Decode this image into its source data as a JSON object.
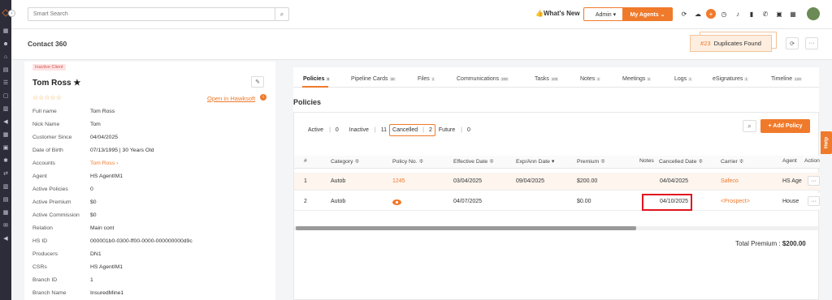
{
  "topbar": {
    "search_placeholder": "Smart Search",
    "whats_new": "👍What's New",
    "admin_label": "Admin ▾",
    "my_agents_label": "My Agents ⌄"
  },
  "header": {
    "title": "Contact 360",
    "duplicates_count": "#23",
    "duplicates_label": "Duplicates Found"
  },
  "contact": {
    "status_tag": "Inactive Client",
    "name": "Tom Ross ★",
    "stars": "☆☆☆☆☆",
    "hawksoft_link": "Open in Hawksoft",
    "fields": [
      {
        "label": "Full name",
        "value": "Tom Ross"
      },
      {
        "label": "Nick Name",
        "value": "Tom"
      },
      {
        "label": "Customer Since",
        "value": "04/04/2025"
      },
      {
        "label": "Date of Birth",
        "value": "07/13/1995 | 30 Years Old"
      },
      {
        "label": "Accounts",
        "value": "Tom Ross ›"
      },
      {
        "label": "Agent",
        "value": "HS AgentIM1"
      },
      {
        "label": "Active Policies",
        "value": "0"
      },
      {
        "label": "Active Premium",
        "value": "$0"
      },
      {
        "label": "Active Commission",
        "value": "$0"
      },
      {
        "label": "Relation",
        "value": "Main cont"
      },
      {
        "label": "HS ID",
        "value": "000001b0-0300-ff00-0000-000000000d9c"
      },
      {
        "label": "Producers",
        "value": "DN1"
      },
      {
        "label": "CSRs",
        "value": "HS AgentIM1"
      },
      {
        "label": "Branch ID",
        "value": "1"
      },
      {
        "label": "Branch Name",
        "value": "InsuredMine1"
      }
    ]
  },
  "tabs": [
    {
      "label": "Policies",
      "count": "8"
    },
    {
      "label": "Pipeline Cards",
      "count": "38"
    },
    {
      "label": "Files",
      "count": "1"
    },
    {
      "label": "Communications",
      "count": "209"
    },
    {
      "label": "Tasks",
      "count": "100"
    },
    {
      "label": "Notes",
      "count": "4"
    },
    {
      "label": "Meetings",
      "count": "5"
    },
    {
      "label": "Logs",
      "count": "1"
    },
    {
      "label": "eSignatures",
      "count": "1"
    },
    {
      "label": "Timeline",
      "count": "129"
    }
  ],
  "policies": {
    "title": "Policies",
    "filters": {
      "active_label": "Active",
      "active_count": "0",
      "inactive_label": "Inactive",
      "inactive_count": "11",
      "cancelled_label": "Cancelled",
      "cancelled_count": "2",
      "future_label": "Future",
      "future_count": "0"
    },
    "add_button": "+ Add Policy",
    "columns": [
      "#",
      "Category ≑",
      "Policy No. ≑",
      "Effective Date ≑",
      "Exp/Ann Date ▾",
      "Premium ≑",
      "Notes",
      "Cancelled Date ≑",
      "Carrier ≑",
      "Agent",
      "Action"
    ],
    "rows": [
      {
        "num": "1",
        "category": "Autob",
        "policy_no": "1245",
        "effective": "03/04/2025",
        "exp": "09/04/2025",
        "premium": "$200.00",
        "cancelled": "04/04/2025",
        "carrier": "Safeco",
        "agent": "HS Age"
      },
      {
        "num": "2",
        "category": "Autob",
        "policy_no": "",
        "effective": "04/07/2025",
        "exp": "",
        "premium": "$0.00",
        "cancelled": "04/10/2025",
        "carrier": "<Prospect>",
        "agent": "House"
      }
    ],
    "total_label": "Total Premium :",
    "total_value": "$200.00"
  },
  "help_label": "Help"
}
